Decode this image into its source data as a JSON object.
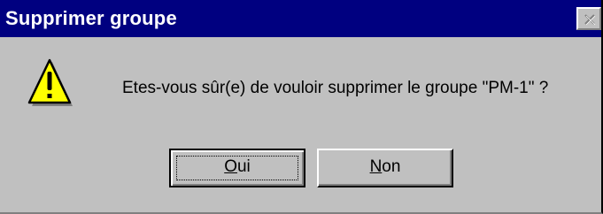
{
  "window": {
    "title": "Supprimer groupe",
    "close_icon": "close-x-icon"
  },
  "dialog": {
    "icon": "warning-icon",
    "message": "Etes-vous sûr(e) de vouloir supprimer le groupe \"PM-1\" ?"
  },
  "buttons": {
    "yes": {
      "accel": "O",
      "rest": "ui"
    },
    "no": {
      "accel": "N",
      "rest": "on"
    }
  },
  "colors": {
    "titlebar": "#000080",
    "face": "#c0c0c0",
    "warning_fill": "#ffff00"
  }
}
